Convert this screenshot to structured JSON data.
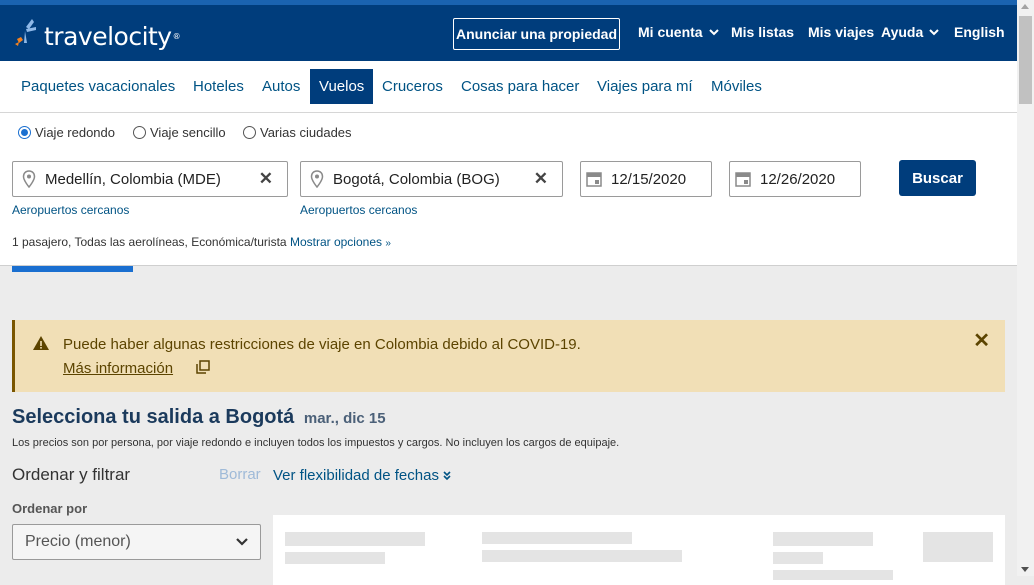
{
  "header": {
    "brand": "travelocity",
    "list_property": "Anunciar una propiedad",
    "account": "Mi cuenta",
    "lists": "Mis listas",
    "trips": "Mis viajes",
    "help": "Ayuda",
    "language": "English"
  },
  "nav": [
    "Paquetes vacacionales",
    "Hoteles",
    "Autos",
    "Vuelos",
    "Cruceros",
    "Cosas para hacer",
    "Viajes para mí",
    "Móviles"
  ],
  "search": {
    "trip_types": [
      "Viaje redondo",
      "Viaje sencillo",
      "Varias ciudades"
    ],
    "selected_trip_type": "Viaje redondo",
    "origin": "Medellín, Colombia (MDE)",
    "destination": "Bogotá, Colombia (BOG)",
    "depart_date": "12/15/2020",
    "return_date": "12/26/2020",
    "nearby_airports": "Aeropuertos cercanos",
    "search_button": "Buscar",
    "options_summary": "1 pasajero, Todas las aerolíneas, Económica/turista",
    "show_options": "Mostrar opciones"
  },
  "alert": {
    "message": "Puede haber algunas restricciones de viaje en Colombia debido al COVID-19.",
    "more_info": "Más información"
  },
  "results": {
    "heading": "Selecciona tu salida a Bogotá",
    "date": "mar., dic 15",
    "disclaimer": "Los precios son por persona, por viaje redondo e incluyen todos los impuestos y cargos. No incluyen los cargos de equipaje.",
    "sort_filter": "Ordenar y filtrar",
    "clear": "Borrar",
    "flex_dates": "Ver flexibilidad de fechas",
    "sort_by_label": "Ordenar por",
    "sort_by_value": "Precio (menor)"
  },
  "colors": {
    "header_bg": "#003d7c",
    "link": "#005384",
    "alert_bg": "#f1dfb6"
  }
}
